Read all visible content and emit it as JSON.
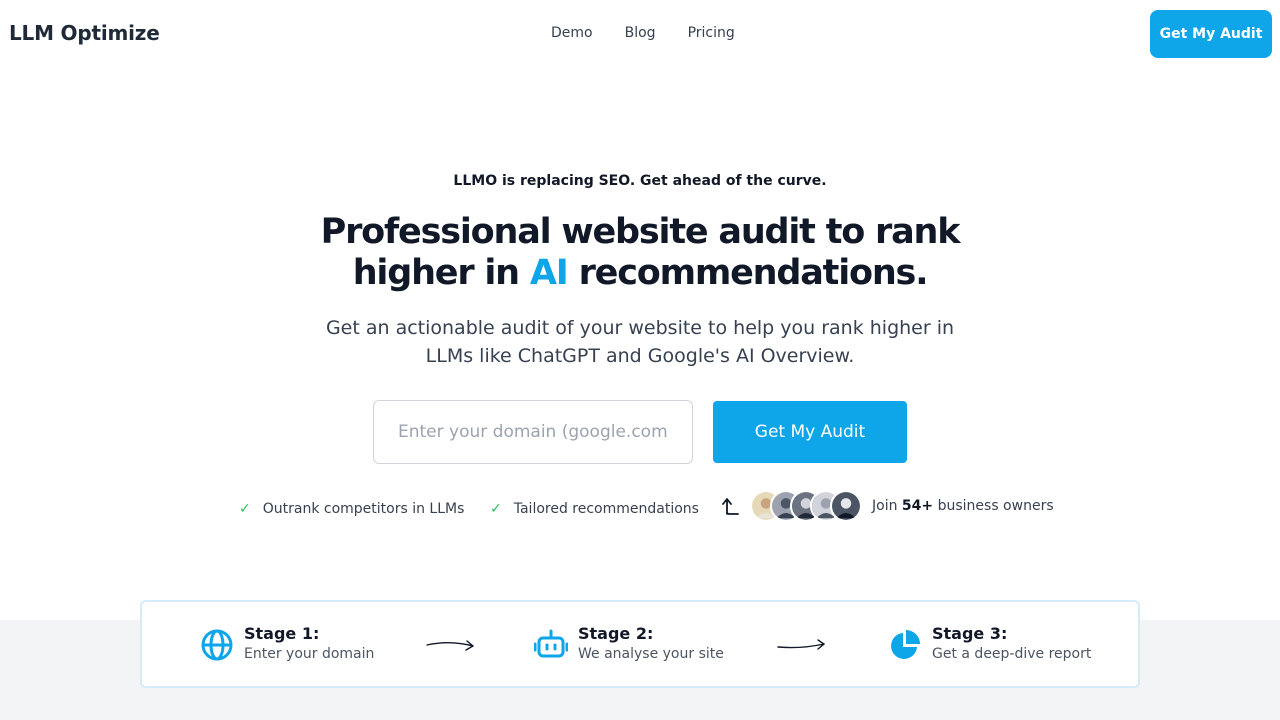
{
  "header": {
    "logo": "LLM Optimize",
    "nav": [
      "Demo",
      "Blog",
      "Pricing"
    ],
    "cta_label": "Get My Audit"
  },
  "hero": {
    "tagline": "LLMO is replacing SEO. Get ahead of the curve.",
    "headline_part1": "Professional website audit to rank",
    "headline_part2": "higher in",
    "headline_accent": "AI",
    "headline_part3": "recommendations.",
    "subtitle": "Get an actionable audit of your website to help you rank higher in LLMs like ChatGPT and Google's AI Overview.",
    "input_placeholder": "Enter your domain (google.com)",
    "cta_label": "Get My Audit",
    "perks": [
      "Outrank competitors in LLMs",
      "Tailored recommendations"
    ],
    "social_prefix": "Join",
    "social_count": "54+",
    "social_suffix": "business owners"
  },
  "stages": [
    {
      "title": "Stage 1:",
      "desc": "Enter your domain",
      "icon": "globe-icon"
    },
    {
      "title": "Stage 2:",
      "desc": "We analyse your site",
      "icon": "robot-icon"
    },
    {
      "title": "Stage 3:",
      "desc": "Get a deep-dive report",
      "icon": "pie-chart-icon"
    }
  ],
  "colors": {
    "accent": "#0ea5e9",
    "check": "#22c55e",
    "text": "#111827",
    "stage_border": "#d5ecf7",
    "section_bg": "#f3f4f6"
  }
}
